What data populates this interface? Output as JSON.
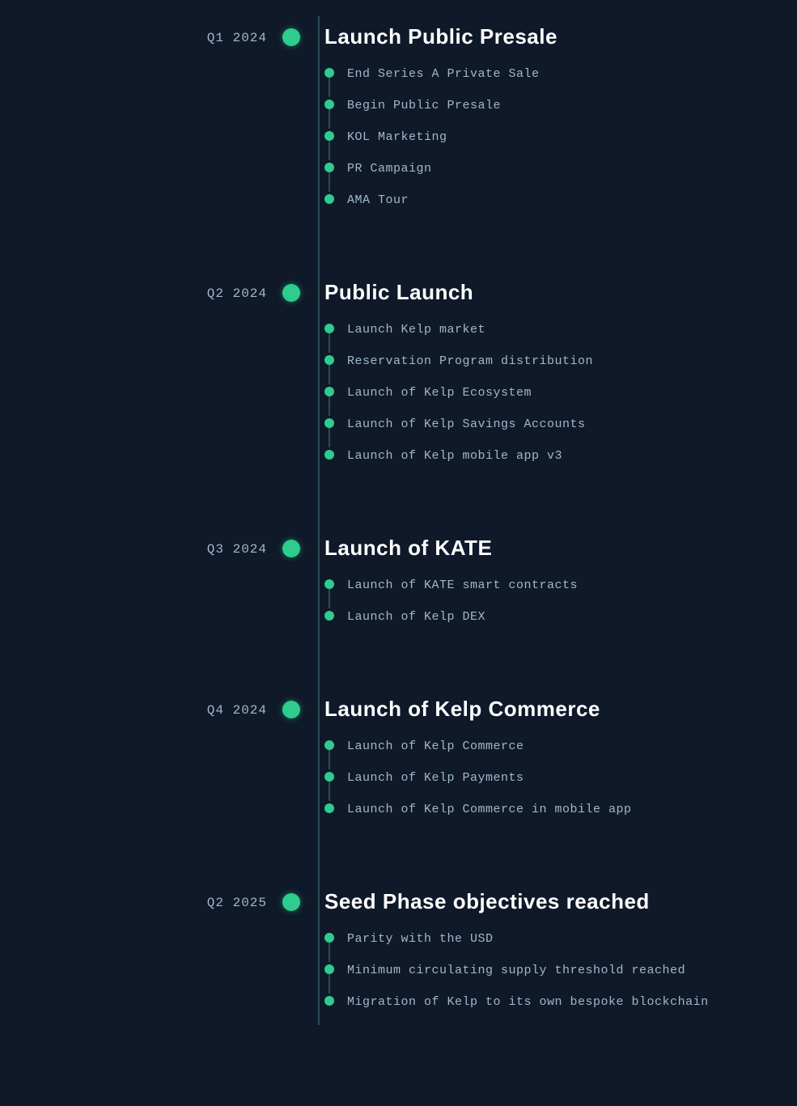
{
  "timeline": {
    "line_color": "#2a4a5a",
    "dot_color": "#2ecc8e",
    "sections": [
      {
        "date": "Q1  2024",
        "title": "Launch Public Presale",
        "items": [
          "End Series A Private Sale",
          "Begin Public Presale",
          "KOL Marketing",
          "PR Campaign",
          "AMA Tour"
        ]
      },
      {
        "date": "Q2  2024",
        "title": "Public Launch",
        "items": [
          "Launch Kelp market",
          "Reservation Program distribution",
          "Launch of Kelp Ecosystem",
          "Launch of Kelp Savings Accounts",
          "Launch of Kelp mobile app v3"
        ]
      },
      {
        "date": "Q3  2024",
        "title": "Launch of KATE",
        "items": [
          "Launch of KATE smart contracts",
          "Launch of Kelp DEX"
        ]
      },
      {
        "date": "Q4  2024",
        "title": "Launch of Kelp Commerce",
        "items": [
          "Launch of Kelp Commerce",
          "Launch of Kelp Payments",
          "Launch of Kelp Commerce in mobile app"
        ]
      },
      {
        "date": "Q2  2025",
        "title": "Seed Phase objectives reached",
        "items": [
          "Parity with the USD",
          "Minimum circulating supply threshold reached",
          "Migration of Kelp to its own bespoke blockchain"
        ]
      }
    ]
  }
}
